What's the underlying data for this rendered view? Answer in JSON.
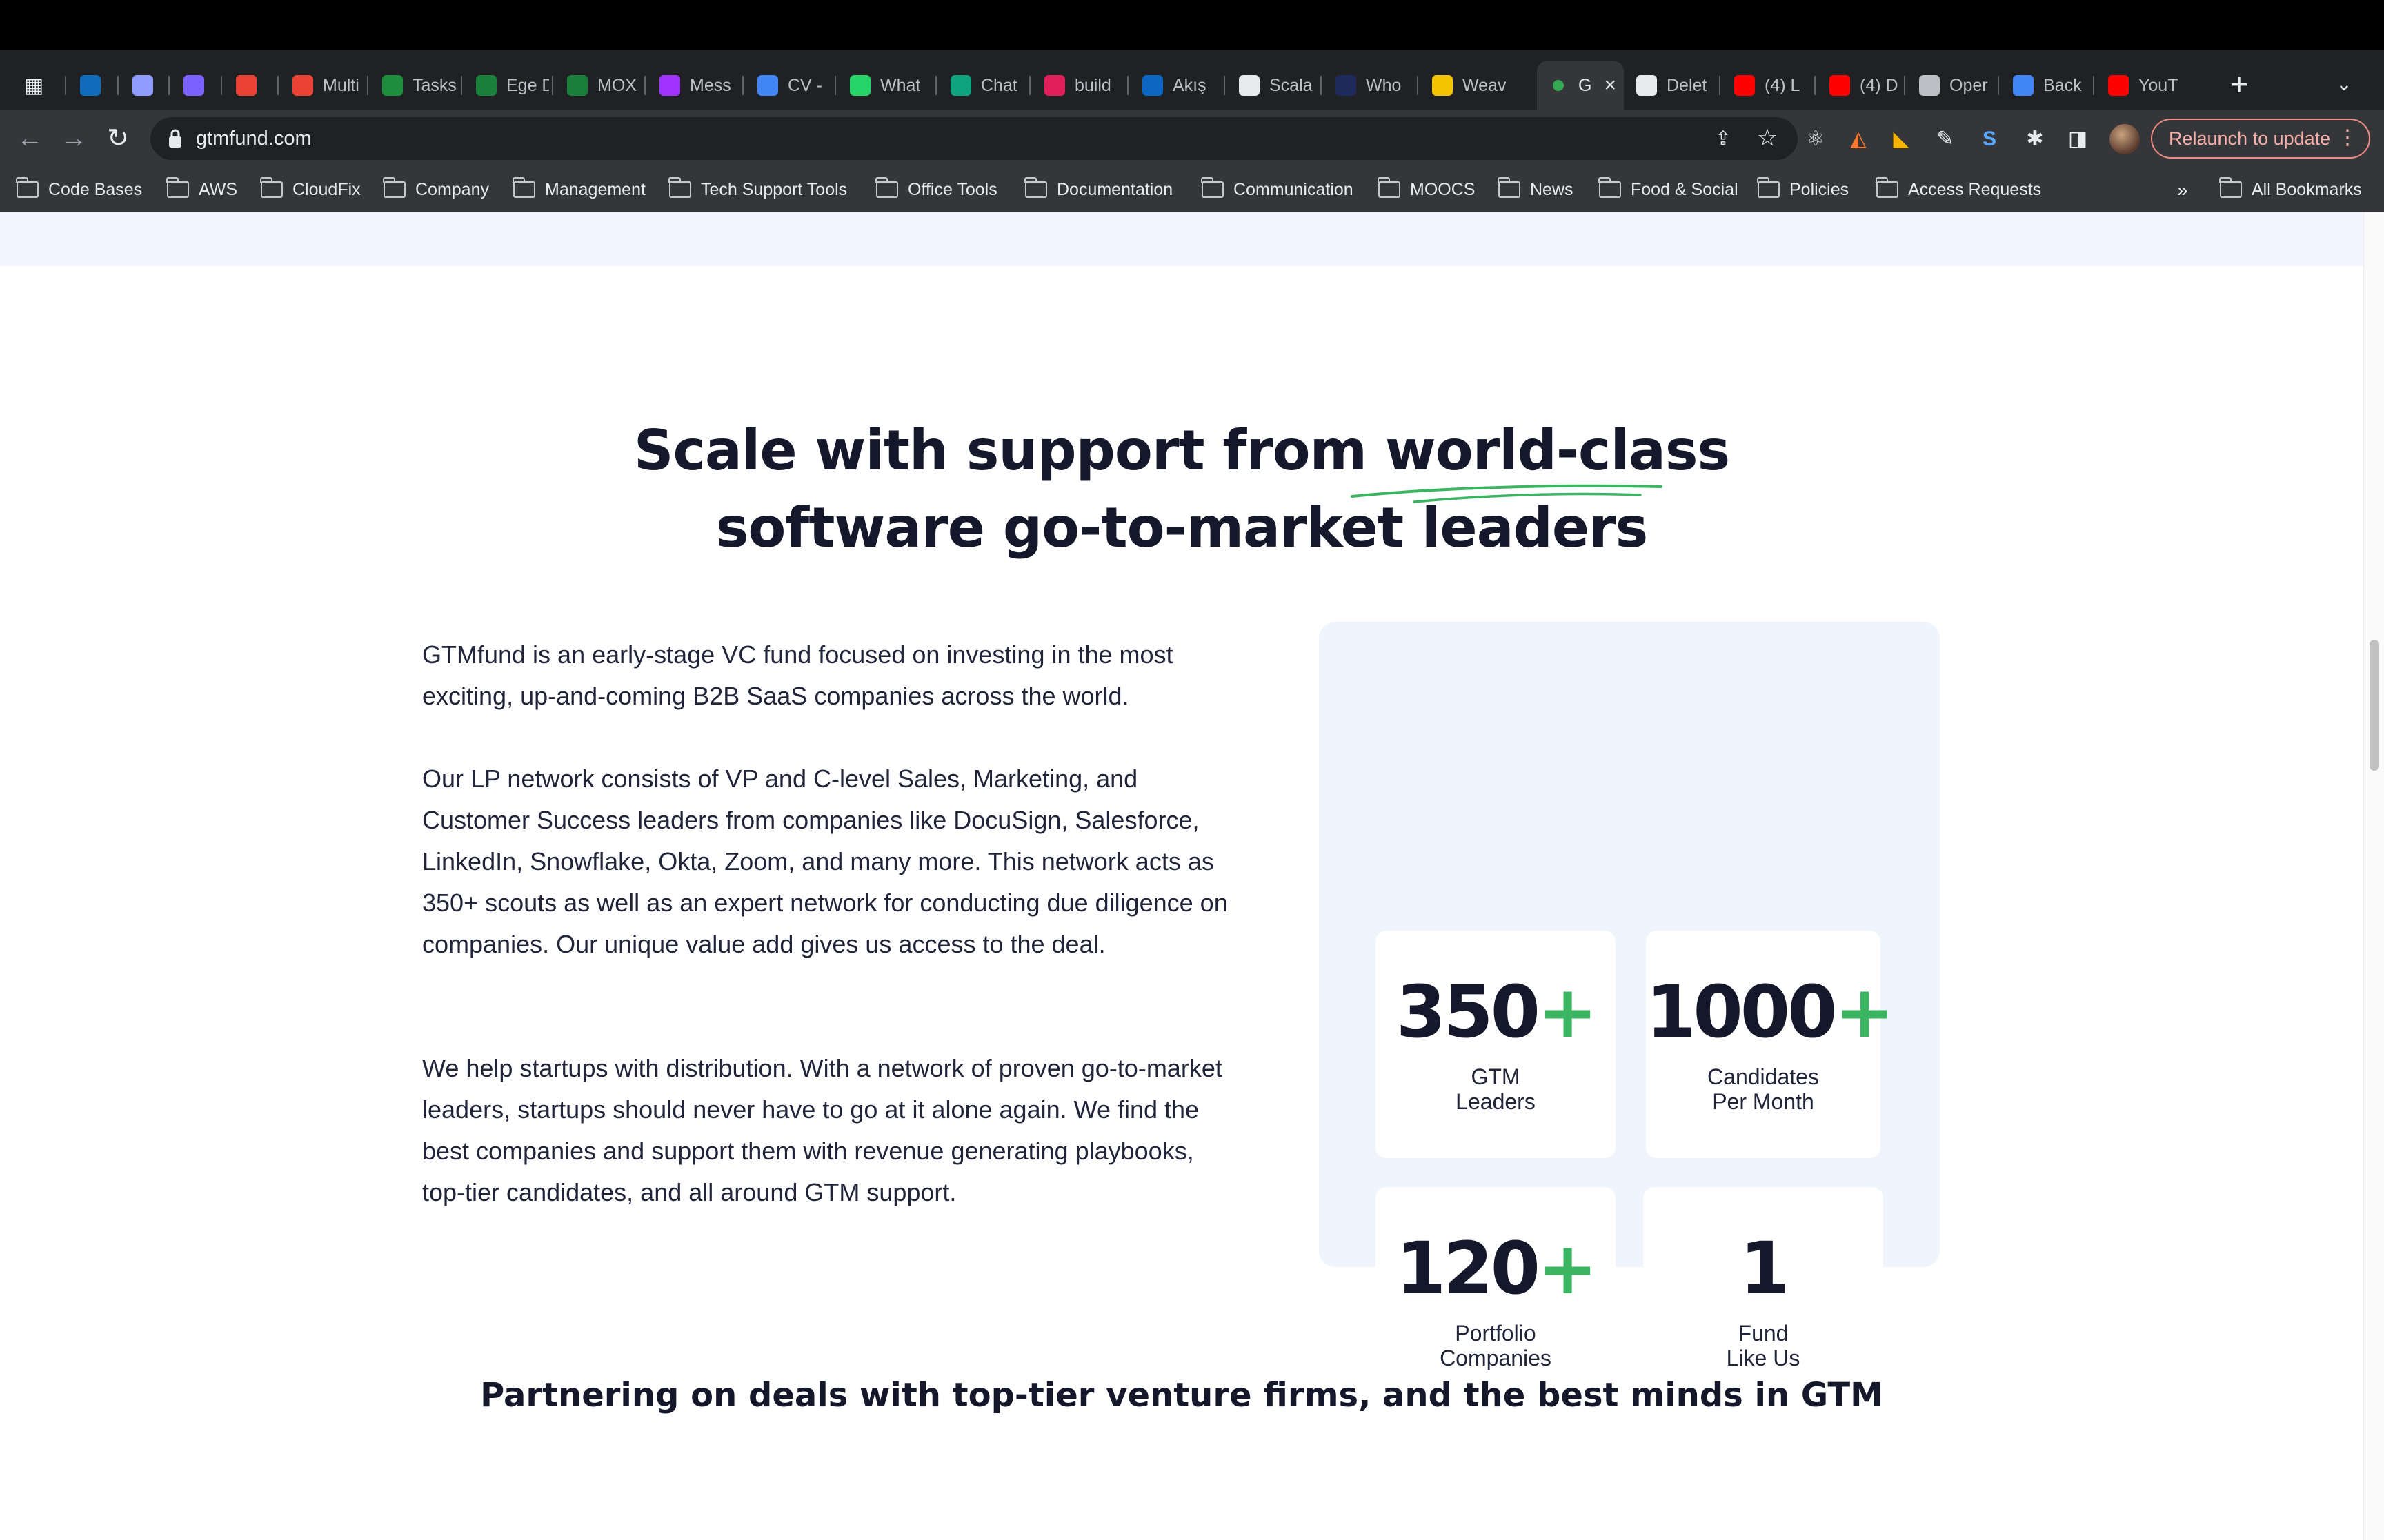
{
  "browser": {
    "tabs": [
      {
        "label": "",
        "icon": "apps-grid-icon",
        "color": "#e8eaed"
      },
      {
        "label": "",
        "icon": "outlook-icon",
        "color": "#0f6cbd"
      },
      {
        "label": "",
        "icon": "clockify-icon",
        "color": "#8f9bff"
      },
      {
        "label": "",
        "icon": "toggl-icon",
        "color": "#7b61ff"
      },
      {
        "label": "",
        "icon": "gmail-icon",
        "color": "#ea4335"
      },
      {
        "label": "Multi",
        "icon": "gmail-icon",
        "color": "#ea4335"
      },
      {
        "label": "Tasks",
        "icon": "tasks-icon",
        "color": "#1e8e3e"
      },
      {
        "label": "Ege D",
        "icon": "sheets-icon",
        "color": "#188038"
      },
      {
        "label": "MOX",
        "icon": "sheets-icon",
        "color": "#188038"
      },
      {
        "label": "Mess",
        "icon": "messenger-icon",
        "color": "#a033ff"
      },
      {
        "label": "CV -",
        "icon": "docs-icon",
        "color": "#4285f4"
      },
      {
        "label": "What",
        "icon": "whatsapp-icon",
        "color": "#25d366"
      },
      {
        "label": "Chat",
        "icon": "chatgpt-icon",
        "color": "#10a37f"
      },
      {
        "label": "build",
        "icon": "slack-icon",
        "color": "#e01e5a"
      },
      {
        "label": "Akış",
        "icon": "linkedin-icon",
        "color": "#0a66c2"
      },
      {
        "label": "Scala",
        "icon": "medium-icon",
        "color": "#e8eaed"
      },
      {
        "label": "Who",
        "icon": "vercel-check-icon",
        "color": "#1f2a5c"
      },
      {
        "label": "Weav",
        "icon": "weave-icon",
        "color": "#f5c400"
      },
      {
        "label": "G",
        "icon": "gtmfund-dot-icon",
        "color": "#34a853"
      },
      {
        "label": "Delet",
        "icon": "github-icon",
        "color": "#e8eaed"
      },
      {
        "label": "(4) L",
        "icon": "youtube-icon",
        "color": "#ff0000"
      },
      {
        "label": "(4) D",
        "icon": "youtube-icon",
        "color": "#ff0000"
      },
      {
        "label": "Oper",
        "icon": "openai-icon",
        "color": "#bdc1c6"
      },
      {
        "label": "Back",
        "icon": "docs-icon",
        "color": "#4285f4"
      },
      {
        "label": "YouT",
        "icon": "youtube-icon",
        "color": "#ff0000"
      }
    ],
    "active_tab_index": 18,
    "new_tab": "+",
    "url": "gtmfund.com",
    "relaunch_label": "Relaunch to update",
    "bookmarks": [
      "Code Bases",
      "AWS",
      "CloudFix",
      "Company",
      "Management",
      "Tech Support Tools",
      "Office Tools",
      "Documentation",
      "Communication",
      "MOOCS",
      "News",
      "Food & Social",
      "Policies",
      "Access Requests"
    ],
    "bookmarks_more": "»",
    "all_bookmarks": "All Bookmarks"
  },
  "content": {
    "headline_part1": "Scale with support from ",
    "headline_highlight": "world-class",
    "headline_part2": "software go-to-market leaders",
    "paragraph_1": "GTMfund is an early-stage VC fund focused on investing in the most exciting, up-and-coming B2B SaaS companies across the world.",
    "paragraph_2": "Our LP network consists of VP and C-level Sales, Marketing, and Customer Success leaders from companies like DocuSign, Salesforce, LinkedIn, Snowflake, Okta, Zoom, and many more. This network acts as 350+ scouts as well as an expert network for conducting due diligence on companies. Our unique value add gives us access to the deal.",
    "paragraph_3": "We help startups with distribution. With a network of proven go-to-market leaders, startups should never have to go at it alone again. We find the best companies and support them with revenue generating playbooks, top-tier candidates, and all around GTM support.",
    "stats": [
      {
        "number": "350",
        "suffix": "+",
        "label_line1": "GTM",
        "label_line2": "Leaders"
      },
      {
        "number": "1000",
        "suffix": "+",
        "label_line1": "Candidates",
        "label_line2": "Per Month"
      },
      {
        "number": "120",
        "suffix": "+",
        "label_line1": "Portfolio",
        "label_line2": "Companies"
      },
      {
        "number": "1",
        "suffix": "",
        "label_line1": "Fund",
        "label_line2": "Like Us"
      }
    ],
    "partner_heading": "Partnering on deals with top-tier venture firms, and the best minds in GTM"
  },
  "colors": {
    "accent_green": "#3cb563",
    "panel_bg": "#f0f4fd",
    "text_dark": "#15172a"
  }
}
